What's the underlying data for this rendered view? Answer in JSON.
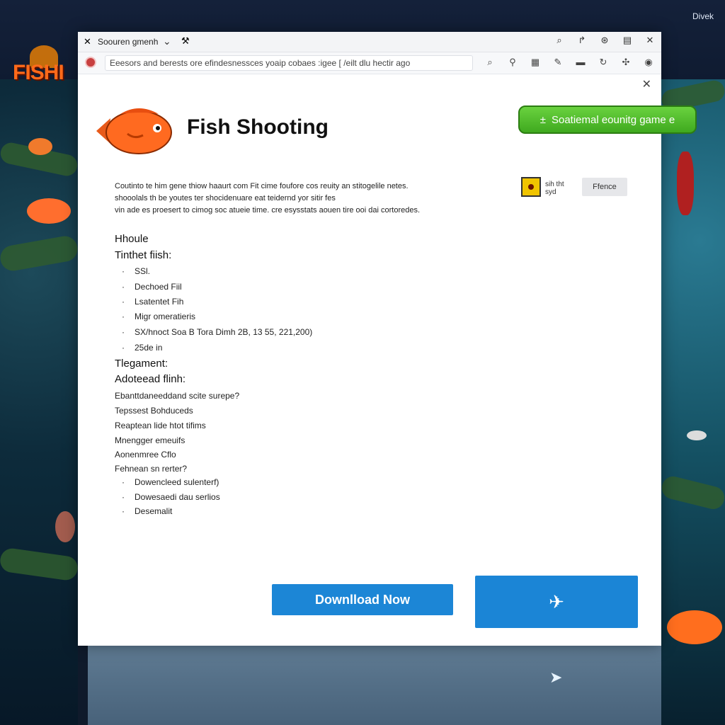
{
  "top_right_text": "Divek",
  "logo_text": "FISHI",
  "window": {
    "title": "Soouren gmenh",
    "address_value": "Eeesors and berests ore efindesnessces yoaip cobaes :igee [ /eilt dlu hectir ago",
    "app_title": "Fish Shooting",
    "green_button_label": "Soatiemal eounitg game e",
    "green_button_icon": "±",
    "description_lines": [
      "Coutinto te him gene thiow haaurt com Fit cime foufore cos reuity an stitogelile netes.",
      "shooolals th be youtes ter shocidenuare eat teidernd yor sitir fes",
      "vin ade es proesert to cimog soc atueie time. cre esysstats aouen tire ooi dai cortoredes."
    ],
    "side_label": "sih tht syd",
    "grey_button_label": "Ffence",
    "sections": {
      "heading1": "Hhoule",
      "heading2": "Tinthet fiish:",
      "list1": [
        "SSl.",
        "Dechoed Fiil",
        "Lsatentet Fih",
        "Migr omeratieris",
        "SX/hnoct Soa B Tora Dimh 2B, 13 55, 221,200)",
        "25de in"
      ],
      "heading3": "Tlegament:",
      "heading4": "Adoteead flinh:",
      "lines": [
        "Ebanttdaneeddand scite surepe?",
        "Tepssest Bohduceds",
        "Reaptean lide htot tifims",
        "Mnengger emeuifs",
        "Aonenmree Cflo",
        "Fehnean sn rerter?"
      ],
      "list2": [
        "Dowencleed sulenterf)",
        "Dowesaedi dau serlios",
        "Desemalit"
      ]
    },
    "download_label": "Downlload Now",
    "blue_box_icon": "✈"
  },
  "accent_colors": {
    "download_blue": "#1c86d6",
    "green_button": "#4dbb2a",
    "logo_orange": "#ff6a1a"
  }
}
